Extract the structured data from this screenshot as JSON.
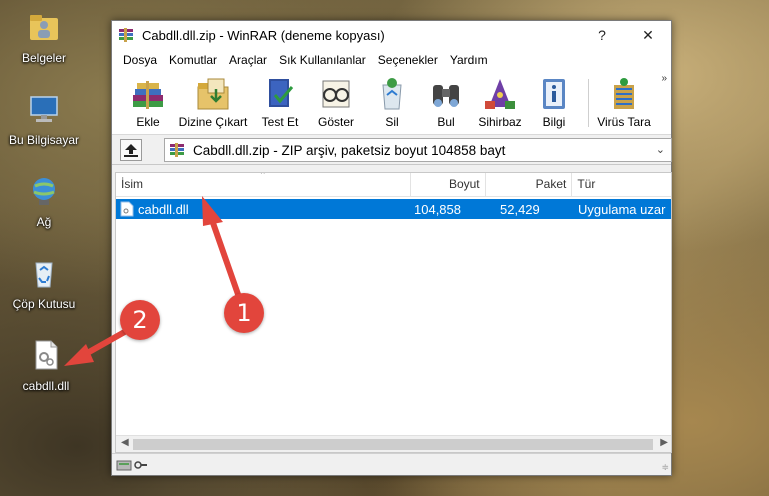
{
  "desktop": {
    "icons": [
      {
        "label": "Belgeler"
      },
      {
        "label": "Bu Bilgisayar"
      },
      {
        "label": "Ağ"
      },
      {
        "label": "Çöp Kutusu"
      },
      {
        "label": "cabdll.dll"
      }
    ]
  },
  "window": {
    "title": "Cabdll.dll.zip - WinRAR (deneme kopyası)",
    "help_button": "?",
    "close_button": "✕"
  },
  "menu": [
    "Dosya",
    "Komutlar",
    "Araçlar",
    "Sık Kullanılanlar",
    "Seçenekler",
    "Yardım"
  ],
  "toolbar": {
    "buttons": [
      {
        "label": "Ekle",
        "icon": "books-icon"
      },
      {
        "label": "Dizine Çıkart",
        "icon": "folder-extract-icon"
      },
      {
        "label": "Test Et",
        "icon": "test-book-icon"
      },
      {
        "label": "Göster",
        "icon": "glasses-icon"
      },
      {
        "label": "Sil",
        "icon": "recycle-icon"
      },
      {
        "label": "Bul",
        "icon": "binoculars-icon"
      },
      {
        "label": "Sihirbaz",
        "icon": "wizard-icon"
      },
      {
        "label": "Bilgi",
        "icon": "info-icon"
      },
      {
        "label": "Virüs Tara",
        "icon": "virus-scan-icon"
      }
    ],
    "overflow": "»"
  },
  "address": {
    "text": "Cabdll.dll.zip - ZIP arşiv, paketsiz boyut 104858 bayt"
  },
  "columns": [
    "İsim",
    "Boyut",
    "Paket",
    "Tür"
  ],
  "files": [
    {
      "name": "cabdll.dll",
      "size": "104,858",
      "packed": "52,429",
      "type": "Uygulama uzar"
    }
  ],
  "annotations": [
    "1",
    "2"
  ],
  "colors": {
    "selection": "#0078d7",
    "annotation": "#e2453c"
  }
}
